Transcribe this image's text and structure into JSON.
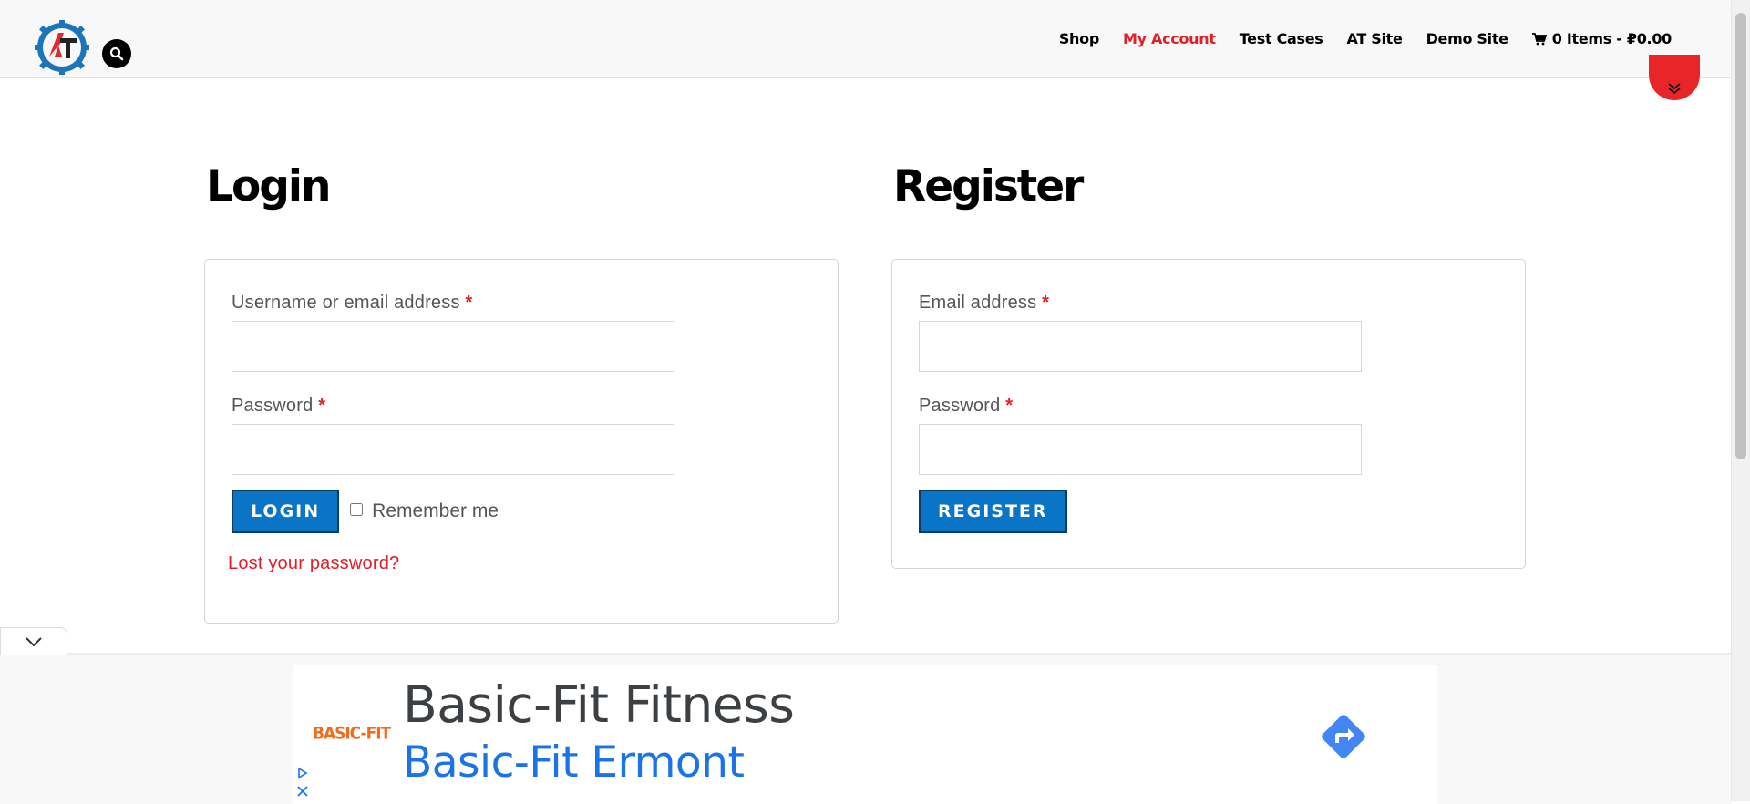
{
  "header": {
    "logo_text": "AT",
    "nav": [
      {
        "label": "Shop"
      },
      {
        "label": "My Account",
        "active": true
      },
      {
        "label": "Test Cases"
      },
      {
        "label": "AT Site"
      },
      {
        "label": "Demo Site"
      },
      {
        "label": "0 Items - ₽0.00",
        "icon": "cart-icon"
      }
    ]
  },
  "login": {
    "title": "Login",
    "username_label": "Username or email address",
    "password_label": "Password",
    "required_mark": "*",
    "button_label": "LOGIN",
    "remember_label": "Remember me",
    "lost_password_link": "Lost your password?"
  },
  "register": {
    "title": "Register",
    "email_label": "Email address",
    "password_label": "Password",
    "required_mark": "*",
    "button_label": "REGISTER"
  },
  "ad": {
    "logo_text": "BASIC-FIT",
    "title": "Basic-Fit Fitness",
    "subtitle": "Basic-Fit Ermont"
  },
  "colors": {
    "accent_red": "#e21f26",
    "button_blue": "#0a74c6",
    "ad_blue": "#1a73e8"
  }
}
